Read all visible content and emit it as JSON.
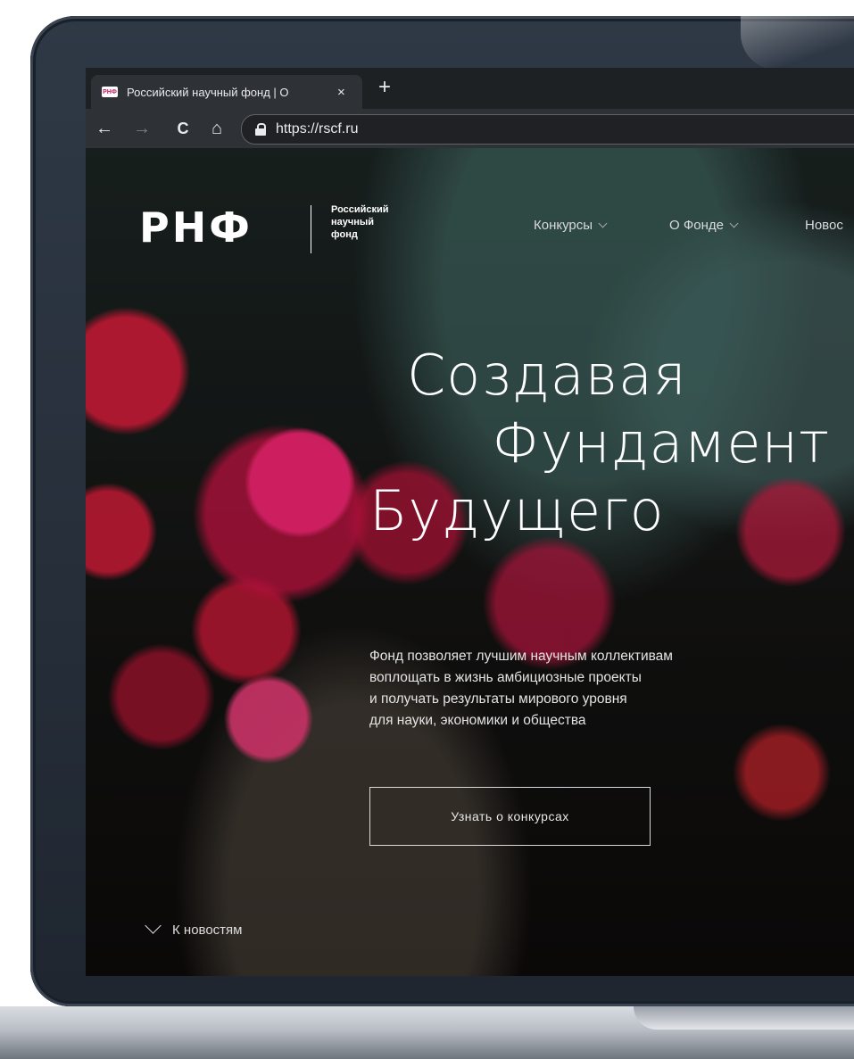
{
  "browser": {
    "tab_title": "Российский научный фонд | О",
    "tab_close": "×",
    "new_tab": "+",
    "url": "https://rscf.ru",
    "back": "←",
    "forward": "→",
    "reload": "C",
    "home": "⌂",
    "favicon_text": "РНФ"
  },
  "site": {
    "logo": "РНФ",
    "logo_lines": [
      "Российский",
      "научный",
      "фонд"
    ],
    "nav": [
      {
        "label": "Конкурсы"
      },
      {
        "label": "О Фонде"
      },
      {
        "label": "Новос"
      }
    ],
    "headline": [
      "Создавая",
      "Фундамент",
      "Будущего"
    ],
    "lead": [
      "Фонд позволяет лучшим научным коллективам",
      "воплощать в жизнь амбициозные проекты",
      "и получать результаты мирового уровня",
      "для науки, экономики и общества"
    ],
    "cta": "Узнать о конкурсах",
    "news_link": "К новостям"
  }
}
